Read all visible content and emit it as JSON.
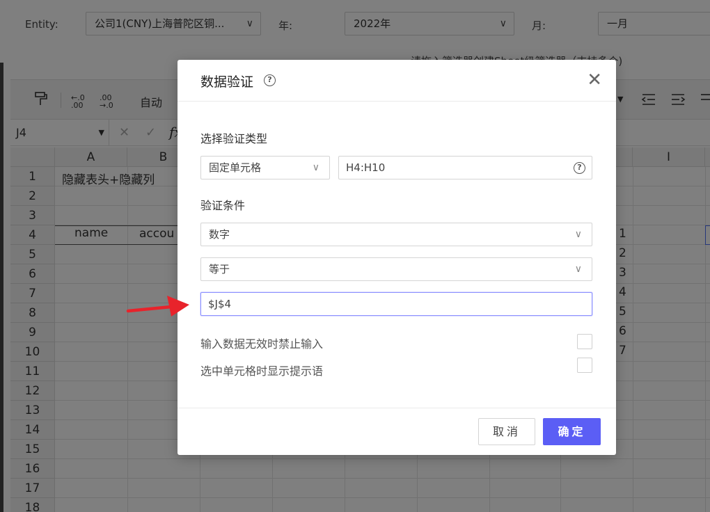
{
  "filters": {
    "entity_label": "Entity:",
    "entity_value": "公司1(CNY)上海普陀区铜...",
    "year_label": "年:",
    "year_value": "2022年",
    "month_label": "月:",
    "month_value": "一月",
    "hint_text": "请拖入筛选器创建Sheet级筛选器（支持多个)"
  },
  "toolbar": {
    "format_painter_icon": "paint-roller",
    "inc_decimal_top": "←.0",
    "inc_decimal_bottom": ".00",
    "dec_decimal_top": ".00",
    "dec_decimal_bottom": "→.0",
    "auto_label": "自动"
  },
  "formula_bar": {
    "cell_ref": "J4",
    "fx": "fx"
  },
  "sheet": {
    "columns": [
      "A",
      "B",
      "I"
    ],
    "rows": [
      "1",
      "2",
      "3",
      "4",
      "5",
      "6",
      "7",
      "8",
      "9",
      "10",
      "11",
      "12",
      "13",
      "14",
      "15",
      "16",
      "17",
      "18"
    ],
    "a1": "隐藏表头+隐藏列",
    "a4": "name",
    "b4": "accou",
    "side_values": [
      "1",
      "2",
      "3",
      "4",
      "5",
      "6",
      "7"
    ]
  },
  "dialog": {
    "title": "数据验证",
    "section_type_label": "选择验证类型",
    "type_select": "固定单元格",
    "range_input": "H4:H10",
    "section_condition_label": "验证条件",
    "condition_select": "数字",
    "operator_select": "等于",
    "value_input": "$J$4",
    "option_block_invalid": "输入数据无效时禁止输入",
    "option_show_prompt": "选中单元格时显示提示语",
    "cancel_label": "取消",
    "ok_label": "确定",
    "accent_color": "#5b5ef5"
  },
  "annotation": {
    "arrow_color": "#e8232b"
  }
}
